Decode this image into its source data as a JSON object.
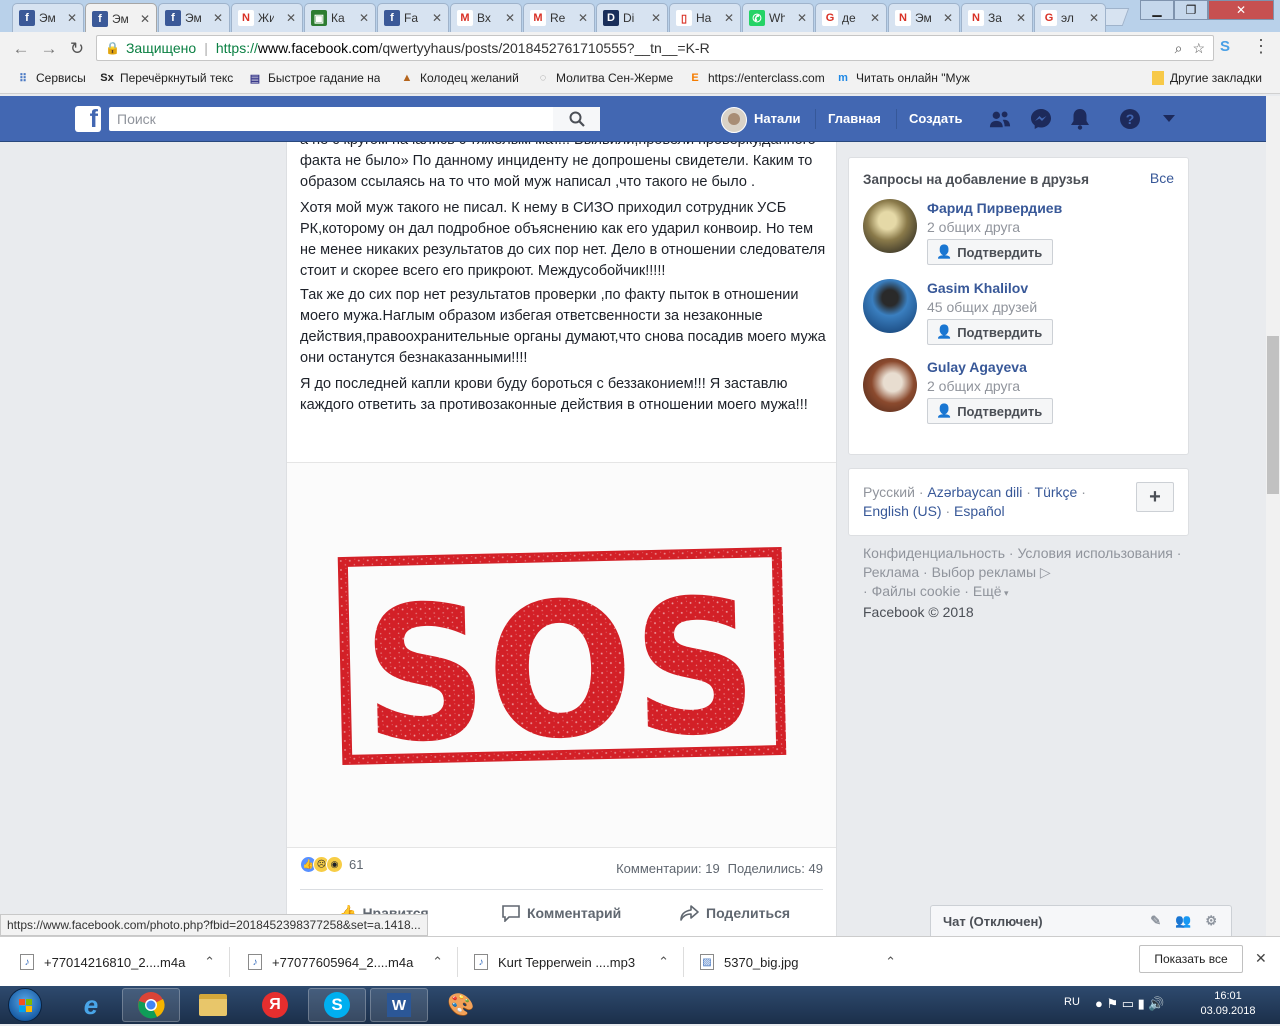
{
  "browser": {
    "tabs": [
      {
        "label": "Эм",
        "icon": "facebook-icon",
        "color": "#3b5998",
        "glyph": "f",
        "active": false
      },
      {
        "label": "Эм",
        "icon": "facebook-icon",
        "color": "#3b5998",
        "glyph": "f",
        "active": true
      },
      {
        "label": "Эм",
        "icon": "facebook-icon",
        "color": "#3b5998",
        "glyph": "f",
        "active": false
      },
      {
        "label": "Жи",
        "icon": "red-n-icon",
        "color": "#ffffff",
        "glyph": "N",
        "active": false
      },
      {
        "label": "Ка",
        "icon": "green-chart-icon",
        "color": "#2e7d32",
        "glyph": "▣",
        "active": false
      },
      {
        "label": "Fa",
        "icon": "facebook-icon",
        "color": "#3b5998",
        "glyph": "f",
        "active": false
      },
      {
        "label": "Вх",
        "icon": "gmail-icon",
        "color": "#ffffff",
        "glyph": "M",
        "active": false
      },
      {
        "label": "Re",
        "icon": "gmail-icon",
        "color": "#ffffff",
        "glyph": "M",
        "active": false
      },
      {
        "label": "Di",
        "icon": "d-icon",
        "color": "#1a2f5a",
        "glyph": "D",
        "active": false
      },
      {
        "label": "На",
        "icon": "page-icon",
        "color": "#ffffff",
        "glyph": "▯",
        "active": false
      },
      {
        "label": "Wh",
        "icon": "whatsapp-icon",
        "color": "#25d366",
        "glyph": "✆",
        "active": false
      },
      {
        "label": "де",
        "icon": "google-icon",
        "color": "#ffffff",
        "glyph": "G",
        "active": false
      },
      {
        "label": "Эм",
        "icon": "red-n-icon",
        "color": "#ffffff",
        "glyph": "N",
        "active": false
      },
      {
        "label": "За",
        "icon": "red-n-icon",
        "color": "#ffffff",
        "glyph": "N",
        "active": false
      },
      {
        "label": "эл",
        "icon": "google-icon",
        "color": "#ffffff",
        "glyph": "G",
        "active": false
      }
    ],
    "secure_label": "Защищено",
    "url_prefix": "https://",
    "url_host": "www.facebook.com",
    "url_path": "/qwertyyhaus/posts/2018452761710555?__tn__=K-R",
    "bookmarks": [
      {
        "label": "Сервисы",
        "icon": "apps-grid-icon",
        "glyph": "⠿",
        "color": "#4a79c4"
      },
      {
        "label": "Перечёркнутый текс",
        "icon": "sx-icon",
        "glyph": "Sx",
        "color": "#222222"
      },
      {
        "label": "Быстрое гадание на",
        "icon": "cards-icon",
        "glyph": "▤",
        "color": "#3a3a8c"
      },
      {
        "label": "Колодец желаний",
        "icon": "well-icon",
        "glyph": "▲",
        "color": "#b5651d"
      },
      {
        "label": "Молитва Сен-Жерме",
        "icon": "loading-page-icon",
        "glyph": "◌",
        "color": "#888888"
      },
      {
        "label": "https://enterclass.com",
        "icon": "enterclass-icon",
        "glyph": "E",
        "color": "#f57c00"
      },
      {
        "label": "Читать онлайн \"Муж",
        "icon": "m-book-icon",
        "glyph": "m",
        "color": "#1e88e5"
      }
    ],
    "other_bookmarks": "Другие закладки",
    "status_url": "https://www.facebook.com/photo.php?fbid=2018452398377258&set=a.1418..."
  },
  "facebook": {
    "search_placeholder": "Поиск",
    "user_name": "Натали",
    "nav_home": "Главная",
    "nav_create": "Создать",
    "post": {
      "paragraphs": [
        "а не с кругом начались с тяжёлым мат... Выявили,провели проверку,данного факта не было» По данному инциденту не допрошены свидетели. Каким то образом ссылаясь на то что мой муж написал ,что такого не было .",
        "Хотя мой муж такого не писал. К нему в СИЗО приходил сотрудник УСБ РК,которому он дал подробное объяснению как его ударил конвоир. Но тем не менее никаких результатов до сих пор нет. Дело в отношении следователя стоит и скорее всего его прикроют. Междусобойчик!!!!!",
        "Так же до сих пор нет результатов проверки ,по факту пыток в отношении моего мужа.Наглым образом избегая ответсвенности за незаконные действия,правоохранительные органы думают,что снова посадив моего мужа они останутся безнаказанными!!!!",
        "Я до последней капли крови буду бороться с беззаконием!!! Я заставлю каждого ответить за противозаконные действия в отношении моего мужа!!!"
      ],
      "image_text": "SOS",
      "reactions_count": "61",
      "comments": "Комментарии: 19",
      "shares": "Поделились: 49",
      "action_like": "Нравится",
      "action_comment": "Комментарий",
      "action_share": "Поделиться"
    },
    "friend_requests": {
      "title": "Запросы на добавление в друзья",
      "see_all": "Все",
      "confirm_label": "Подтвердить",
      "items": [
        {
          "name": "Фарид Пирвердиев",
          "mutual": "2 общих друга"
        },
        {
          "name": "Gasim Khalilov",
          "mutual": "45 общих друзей"
        },
        {
          "name": "Gulay Agayeva",
          "mutual": "2 общих друга"
        }
      ]
    },
    "languages": {
      "current": "Русский",
      "others": [
        "Azərbaycan dili",
        "Türkçe",
        "English (US)",
        "Español"
      ]
    },
    "footer": {
      "privacy": "Конфиденциальность",
      "terms": "Условия использования",
      "ads": "Реклама",
      "ad_choices": "Выбор рекламы",
      "cookies": "Файлы cookie",
      "more": "Ещё",
      "copyright": "Facebook © 2018"
    },
    "chat_label": "Чат (Отключен)"
  },
  "downloads": {
    "items": [
      "+77014216810_2....m4a",
      "+77077605964_2....m4a",
      "Kurt Tepperwein ....mp3",
      "5370_big.jpg"
    ],
    "show_all": "Показать все"
  },
  "taskbar": {
    "language": "RU",
    "time": "16:01",
    "date": "03.09.2018"
  },
  "colors": {
    "facebook_blue": "#4267b2",
    "link_blue": "#385898",
    "sos_red": "#d32027"
  }
}
